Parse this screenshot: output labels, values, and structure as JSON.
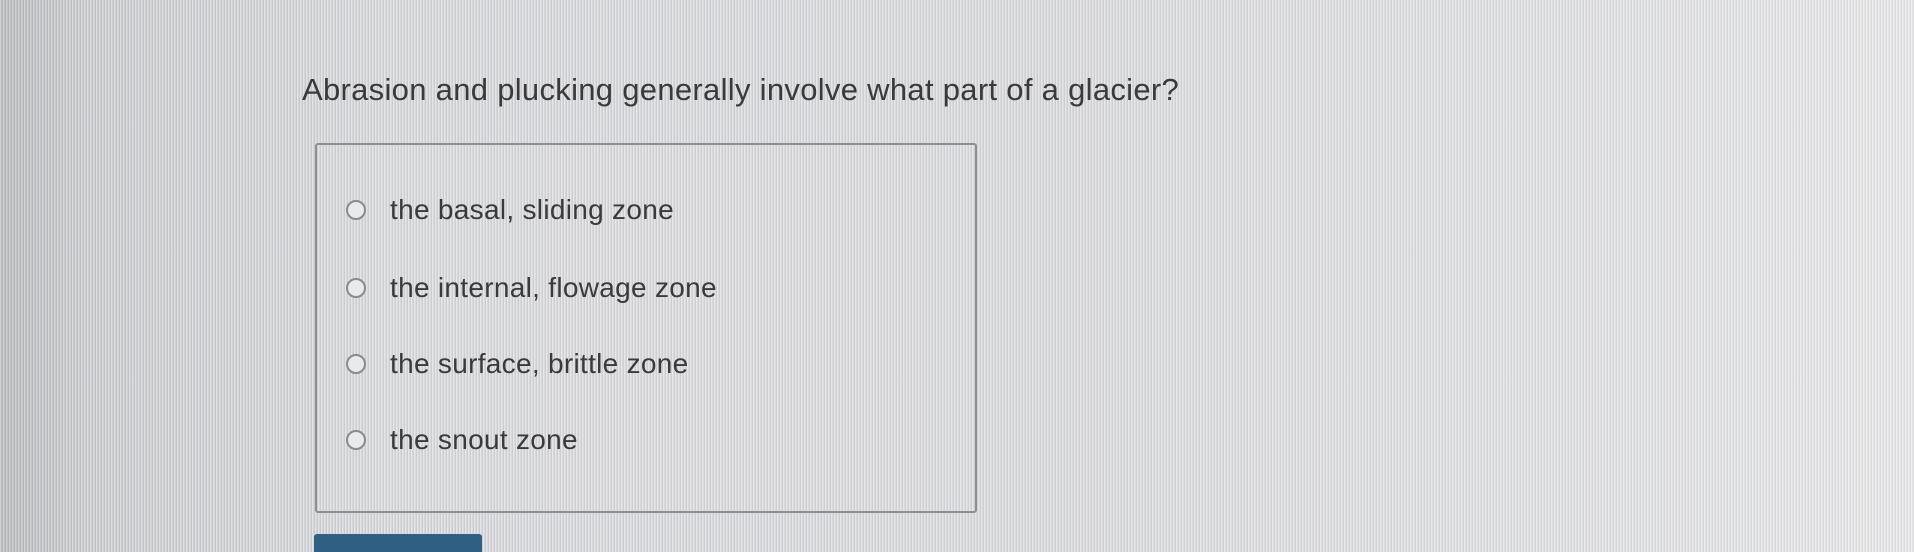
{
  "question": {
    "text": "Abrasion and plucking generally involve what part of a glacier?"
  },
  "options": [
    {
      "label": "the basal, sliding zone",
      "selected": false
    },
    {
      "label": "the internal, flowage zone",
      "selected": false
    },
    {
      "label": "the surface, brittle zone",
      "selected": false
    },
    {
      "label": "the snout zone",
      "selected": false
    }
  ],
  "colors": {
    "button": "#2f5f83",
    "text": "#3a3a3a",
    "border": "#8e8f92"
  }
}
